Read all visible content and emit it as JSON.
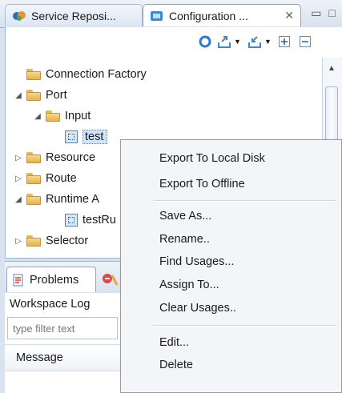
{
  "tabs": [
    {
      "label": "Service Reposi...",
      "icon": "service-repository-icon"
    },
    {
      "label": "Configuration ...",
      "icon": "configuration-icon",
      "close": "✕"
    }
  ],
  "tree": {
    "items": [
      {
        "label": "Connection Factory"
      },
      {
        "label": "Port",
        "expanded": true
      },
      {
        "label": "Input",
        "expanded": true
      },
      {
        "label": "test",
        "selected": true
      },
      {
        "label": "Resource"
      },
      {
        "label": "Route"
      },
      {
        "label": "Runtime A"
      },
      {
        "label": "testRu"
      },
      {
        "label": "Selector"
      }
    ]
  },
  "bottom": {
    "tabs": [
      {
        "label": "Problems"
      },
      {
        "label": ""
      }
    ],
    "workspace_log": "Workspace Log",
    "filter_placeholder": "type filter text",
    "column_header": "Message"
  },
  "context_menu": {
    "items": [
      "Export To Local Disk",
      "Export To Offline",
      "Save As...",
      "Rename..",
      "Find Usages...",
      "Assign To...",
      "Clear Usages..",
      "Edit...",
      "Delete"
    ]
  }
}
